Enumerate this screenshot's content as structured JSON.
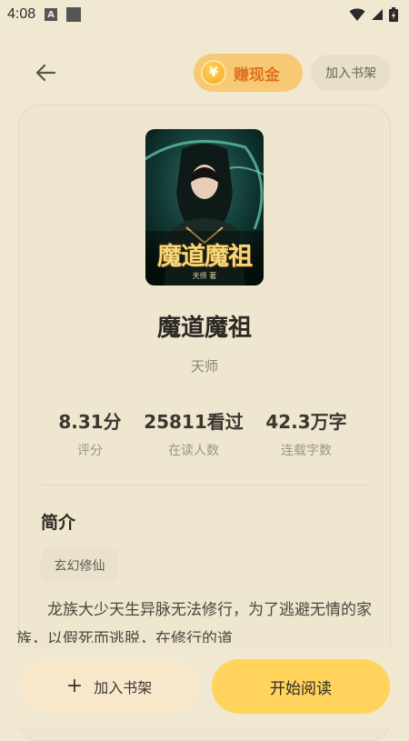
{
  "status_bar": {
    "time": "4:08",
    "badge": "A"
  },
  "header": {
    "earn_label": "赚现金",
    "coin_symbol": "¥",
    "add_to_shelf_label": "加入书架"
  },
  "book": {
    "title": "魔道魔祖",
    "author": "天师",
    "cover": {
      "title_text": "魔道魔祖",
      "subtitle_text": "天师 著"
    },
    "stats": [
      {
        "value": "8.31分",
        "label": "评分"
      },
      {
        "value": "25811看过",
        "label": "在读人数"
      },
      {
        "value": "42.3万字",
        "label": "连载字数"
      }
    ]
  },
  "intro": {
    "heading": "简介",
    "tag": "玄幻修仙",
    "text": "龙族大少天生异脉无法修行，为了逃避无情的家族，以假死而逃脱，在修行的道"
  },
  "actions": {
    "add_shelf_label": "加入书架",
    "start_label": "开始阅读"
  },
  "colors": {
    "background": "#f1e8d2",
    "accent_yellow": "#ffd35c",
    "earn_orange": "#e2711d"
  }
}
